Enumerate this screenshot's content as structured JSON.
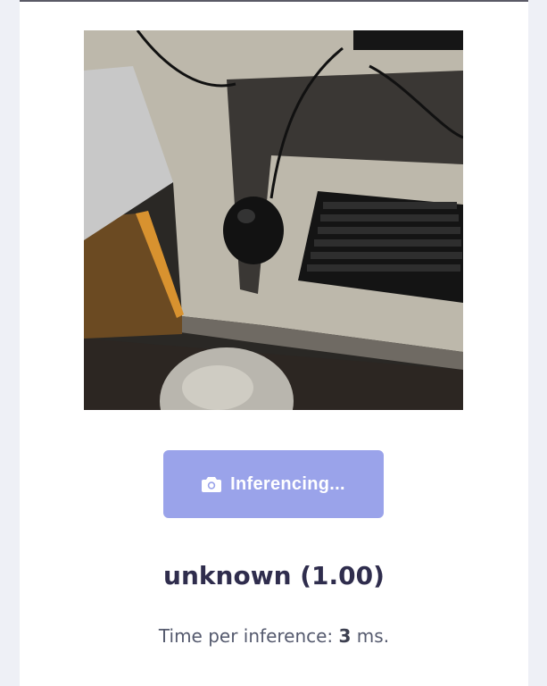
{
  "button": {
    "label": "Inferencing...",
    "icon": "camera-icon"
  },
  "result": {
    "label": "unknown (1.00)"
  },
  "timing": {
    "prefix": "Time per inference: ",
    "value": "3",
    "suffix": " ms."
  },
  "colors": {
    "button_bg": "#9aa3ea",
    "result_text": "#2f2d4d",
    "timing_text": "#555a6e"
  }
}
